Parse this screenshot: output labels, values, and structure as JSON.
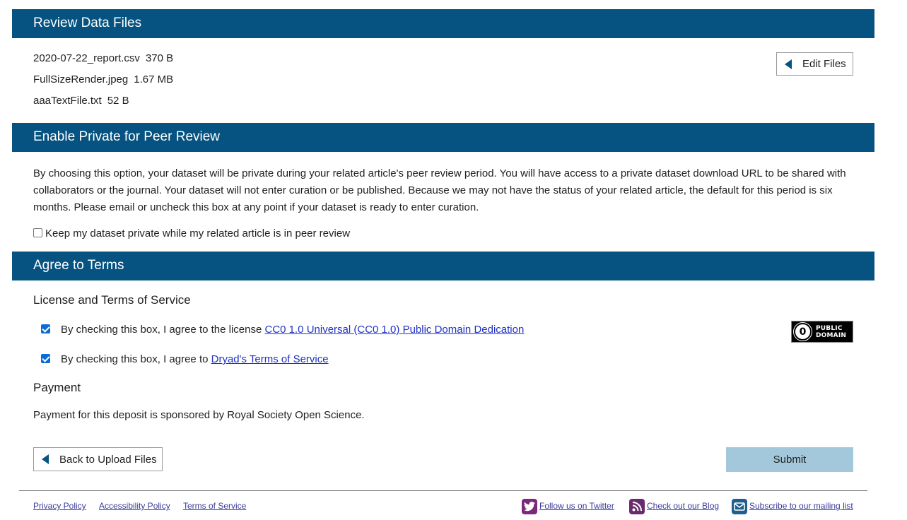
{
  "review": {
    "header": "Review Data Files",
    "files": [
      {
        "name": "2020-07-22_report.csv",
        "size": "370 B"
      },
      {
        "name": "FullSizeRender.jpeg",
        "size": "1.67 MB"
      },
      {
        "name": "aaaTextFile.txt",
        "size": "52 B"
      }
    ],
    "edit_label": "Edit Files"
  },
  "peer_review": {
    "header": "Enable Private for Peer Review",
    "description": "By choosing this option, your dataset will be private during your related article's peer review period. You will have access to a private dataset download URL to be shared with collaborators or the journal. Your dataset will not enter curation or be published. Because we may not have the status of your related article, the default for this period is six months. Please email or uncheck this box at any point if your dataset is ready to enter curation.",
    "checkbox_label": "Keep my dataset private while my related article is in peer review",
    "checked": false
  },
  "terms": {
    "header": "Agree to Terms",
    "license_heading": "License and Terms of Service",
    "license_prefix": "By checking this box, I agree to the license ",
    "license_link": "CC0 1.0 Universal (CC0 1.0) Public Domain Dedication",
    "tos_prefix": "By checking this box, I agree to ",
    "tos_link": "Dryad's Terms of Service",
    "license_checked": true,
    "tos_checked": true,
    "badge_symbol": "0",
    "badge_line1": "PUBLIC",
    "badge_line2": "DOMAIN",
    "payment_heading": "Payment",
    "payment_text": "Payment for this deposit is sponsored by Royal Society Open Science."
  },
  "actions": {
    "back_label": "Back to Upload Files",
    "submit_label": "Submit"
  },
  "footer": {
    "links": [
      "Privacy Policy",
      "Accessibility Policy",
      "Terms of Service"
    ],
    "twitter": "Follow us on Twitter",
    "blog": "Check out our Blog",
    "mailing": "Subscribe to our mailing list"
  },
  "colors": {
    "header_bg": "#065381",
    "submit_bg": "#a3c8db",
    "twitter_icon": "#7a2a7a",
    "blog_icon": "#6b2a6b",
    "mail_icon": "#1f5f8f"
  }
}
